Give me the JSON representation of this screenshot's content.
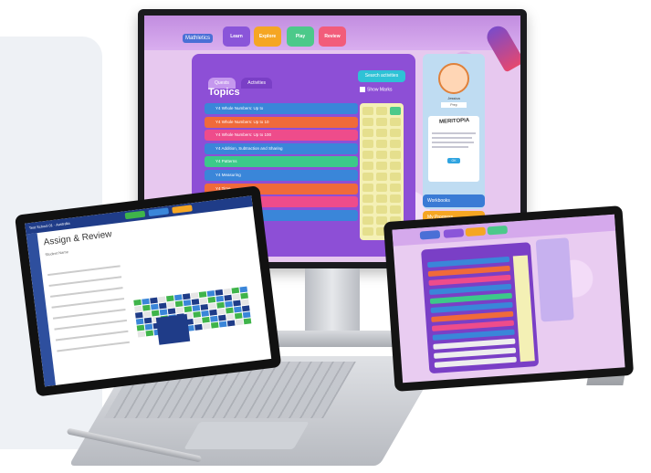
{
  "monitor": {
    "logo": "Mathletics",
    "nav": {
      "learn": "Learn",
      "explore": "Explore",
      "play": "Play",
      "review": "Review"
    },
    "tabs": [
      "Quests",
      "Activities"
    ],
    "search_label": "Search activities",
    "topics_title": "Topics",
    "show_marks": "Show Marks",
    "topics": [
      {
        "label": "Y4 Whole Numbers: Up to",
        "color": "#3a86d9"
      },
      {
        "label": "Y4 Whole Numbers: Up to 10",
        "color": "#f06a3a"
      },
      {
        "label": "Y4 Whole Numbers: Up to 100",
        "color": "#ee4c8b"
      },
      {
        "label": "Y4 Addition, Subtraction and Sharing",
        "color": "#3a86d9"
      },
      {
        "label": "Y4 Patterns",
        "color": "#3cc98a"
      },
      {
        "label": "Y4 Measuring",
        "color": "#3a86d9"
      },
      {
        "label": "Y4 Time",
        "color": "#f06a3a"
      },
      {
        "label": "Y4 Objects and Shapes",
        "color": "#ee4c8b"
      },
      {
        "label": "Y4 Location",
        "color": "#3a86d9"
      }
    ],
    "profile": {
      "name": "Jessica",
      "year": "Prep"
    },
    "merit_title": "MERITOPIA",
    "merit_ok": "OK",
    "workbooks": "Workbooks",
    "my_progress": "My Progress"
  },
  "laptop": {
    "header": "Test School 01 · Australia",
    "title": "Assign & Review",
    "subtitle": "Student Name"
  },
  "colors": {
    "purple": "#8d4fd6",
    "teal": "#2ec2d6",
    "orange": "#f5a623",
    "blue": "#3a7bd5"
  }
}
